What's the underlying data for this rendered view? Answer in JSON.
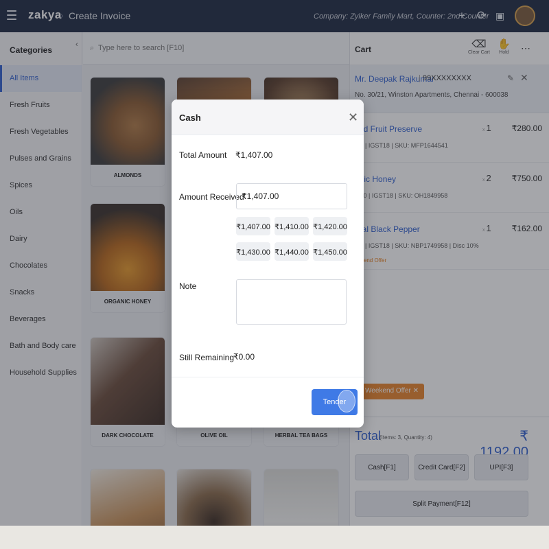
{
  "topbar": {
    "logo": "zakya",
    "page_title": "Create Invoice",
    "company": "Company: Zylker Family Mart,  Counter: 2nd Counter",
    "icons": [
      "menu-icon",
      "plus-icon",
      "refresh-icon",
      "scan-icon",
      "avatar"
    ]
  },
  "categories": {
    "title": "Categories",
    "items": [
      "All Items",
      "Fresh Fruits",
      "Fresh Vegetables",
      "Pulses and Grains",
      "Spices",
      "Oils",
      "Dairy",
      "Chocolates",
      "Snacks",
      "Beverages",
      "Bath and Body care",
      "Household Supplies"
    ],
    "active": "All Items"
  },
  "search": {
    "placeholder": "Type here to search [F10]"
  },
  "products": [
    {
      "name": "ALMONDS"
    },
    {
      "name": "ORGANIC HONEY"
    },
    {
      "name": "DARK CHOCOLATE"
    },
    {
      "name": "OLIVE OIL"
    },
    {
      "name": "HERBAL TEA BAGS"
    }
  ],
  "cart": {
    "title": "Cart",
    "clear_label": "Clear Cart",
    "hold_label": "Hold",
    "customer": {
      "name": "Mr. Deepak Rajkumar",
      "phone": "99XXXXXXXX",
      "address": "No. 30/21, Winston Apartments, Chennai - 600038"
    },
    "items": [
      {
        "name": "zed Fruit Preserve",
        "meta": ".00  |  IGST18  |  SKU: MFP1644541",
        "qty": "1",
        "price": "₹280.00",
        "offer": ""
      },
      {
        "name": "anic Honey",
        "meta": "5.00  |  IGST18  |  SKU: OH1849958",
        "qty": "2",
        "price": "₹750.00",
        "offer": ""
      },
      {
        "name": "ural Black Pepper",
        "meta": ".00  |  IGST18  |  SKU: NBP1749958  |  Disc 10%",
        "qty": "1",
        "price": "₹162.00",
        "offer": "eekend Offer"
      }
    ],
    "qty_prefix": "x",
    "offer_chip": "Weekend Offer",
    "total_label": "Total",
    "total_meta": "(Items: 3, Quantity: 4)",
    "total_value": "₹ 1192.00",
    "buttons": {
      "cash": "Cash[F1]",
      "credit": "Credit Card[F2]",
      "upi": "UPI[F3]",
      "split": "Split Payment[F12]"
    }
  },
  "modal": {
    "title": "Cash",
    "total_label": "Total Amount",
    "total_value": "₹1,407.00",
    "received_label": "Amount Received",
    "received_value": "₹1,407.00",
    "quick_amounts": [
      "₹1,407.00",
      "₹1,410.00",
      "₹1,420.00",
      "₹1,430.00",
      "₹1,440.00",
      "₹1,450.00"
    ],
    "note_label": "Note",
    "note_value": "",
    "remaining_label": "Still Remaining",
    "remaining_value": "₹0.00",
    "tender_label": "Tender"
  }
}
